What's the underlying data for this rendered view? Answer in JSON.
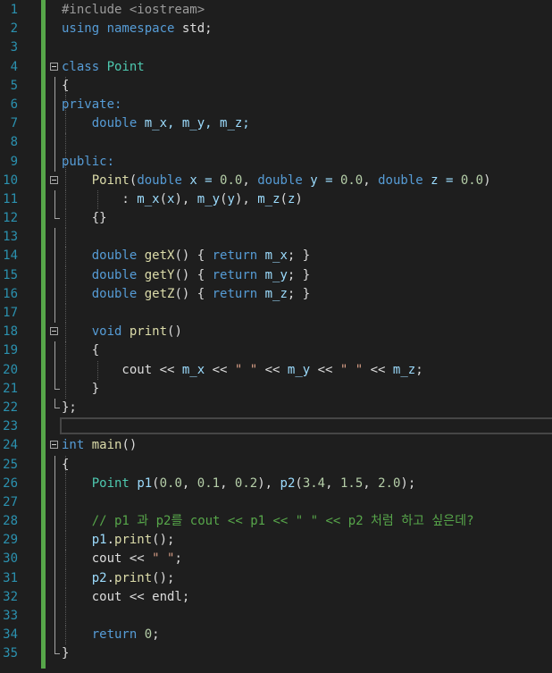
{
  "editor": {
    "current_line": 23,
    "lines": [
      {
        "n": "1",
        "tokens": [
          {
            "t": "#include <iostream>",
            "c": "pp"
          }
        ]
      },
      {
        "n": "2",
        "tokens": [
          {
            "t": "using namespace",
            "c": "kw"
          },
          {
            "t": " std;",
            "c": "pl"
          }
        ]
      },
      {
        "n": "3",
        "tokens": []
      },
      {
        "n": "4",
        "tokens": [
          {
            "t": "class",
            "c": "kw"
          },
          {
            "t": " ",
            "c": "pl"
          },
          {
            "t": "Point",
            "c": "ty"
          }
        ]
      },
      {
        "n": "5",
        "tokens": [
          {
            "t": "{",
            "c": "pl"
          }
        ]
      },
      {
        "n": "6",
        "tokens": [
          {
            "t": "private:",
            "c": "kw"
          }
        ]
      },
      {
        "n": "7",
        "tokens": [
          {
            "t": "    ",
            "c": "pl"
          },
          {
            "t": "double",
            "c": "kw"
          },
          {
            "t": " m_x, m_y, m_z;",
            "c": "var"
          }
        ]
      },
      {
        "n": "8",
        "tokens": []
      },
      {
        "n": "9",
        "tokens": [
          {
            "t": "public:",
            "c": "kw"
          }
        ]
      },
      {
        "n": "10",
        "tokens": [
          {
            "t": "    ",
            "c": "pl"
          },
          {
            "t": "Point",
            "c": "fn"
          },
          {
            "t": "(",
            "c": "pl"
          },
          {
            "t": "double",
            "c": "kw"
          },
          {
            "t": " x = ",
            "c": "var"
          },
          {
            "t": "0.0",
            "c": "num"
          },
          {
            "t": ", ",
            "c": "pl"
          },
          {
            "t": "double",
            "c": "kw"
          },
          {
            "t": " y = ",
            "c": "var"
          },
          {
            "t": "0.0",
            "c": "num"
          },
          {
            "t": ", ",
            "c": "pl"
          },
          {
            "t": "double",
            "c": "kw"
          },
          {
            "t": " z = ",
            "c": "var"
          },
          {
            "t": "0.0",
            "c": "num"
          },
          {
            "t": ")",
            "c": "pl"
          }
        ]
      },
      {
        "n": "11",
        "tokens": [
          {
            "t": "        : ",
            "c": "pl"
          },
          {
            "t": "m_x",
            "c": "var"
          },
          {
            "t": "(",
            "c": "pl"
          },
          {
            "t": "x",
            "c": "var"
          },
          {
            "t": "), ",
            "c": "pl"
          },
          {
            "t": "m_y",
            "c": "var"
          },
          {
            "t": "(",
            "c": "pl"
          },
          {
            "t": "y",
            "c": "var"
          },
          {
            "t": "), ",
            "c": "pl"
          },
          {
            "t": "m_z",
            "c": "var"
          },
          {
            "t": "(",
            "c": "pl"
          },
          {
            "t": "z",
            "c": "var"
          },
          {
            "t": ")",
            "c": "pl"
          }
        ]
      },
      {
        "n": "12",
        "tokens": [
          {
            "t": "    {}",
            "c": "pl"
          }
        ]
      },
      {
        "n": "13",
        "tokens": []
      },
      {
        "n": "14",
        "tokens": [
          {
            "t": "    ",
            "c": "pl"
          },
          {
            "t": "double",
            "c": "kw"
          },
          {
            "t": " ",
            "c": "pl"
          },
          {
            "t": "getX",
            "c": "fn"
          },
          {
            "t": "() { ",
            "c": "pl"
          },
          {
            "t": "return",
            "c": "kw"
          },
          {
            "t": " m_x",
            "c": "var"
          },
          {
            "t": "; }",
            "c": "pl"
          }
        ]
      },
      {
        "n": "15",
        "tokens": [
          {
            "t": "    ",
            "c": "pl"
          },
          {
            "t": "double",
            "c": "kw"
          },
          {
            "t": " ",
            "c": "pl"
          },
          {
            "t": "getY",
            "c": "fn"
          },
          {
            "t": "() { ",
            "c": "pl"
          },
          {
            "t": "return",
            "c": "kw"
          },
          {
            "t": " m_y",
            "c": "var"
          },
          {
            "t": "; }",
            "c": "pl"
          }
        ]
      },
      {
        "n": "16",
        "tokens": [
          {
            "t": "    ",
            "c": "pl"
          },
          {
            "t": "double",
            "c": "kw"
          },
          {
            "t": " ",
            "c": "pl"
          },
          {
            "t": "getZ",
            "c": "fn"
          },
          {
            "t": "() { ",
            "c": "pl"
          },
          {
            "t": "return",
            "c": "kw"
          },
          {
            "t": " m_z",
            "c": "var"
          },
          {
            "t": "; }",
            "c": "pl"
          }
        ]
      },
      {
        "n": "17",
        "tokens": []
      },
      {
        "n": "18",
        "tokens": [
          {
            "t": "    ",
            "c": "pl"
          },
          {
            "t": "void",
            "c": "kw"
          },
          {
            "t": " ",
            "c": "pl"
          },
          {
            "t": "print",
            "c": "fn"
          },
          {
            "t": "()",
            "c": "pl"
          }
        ]
      },
      {
        "n": "19",
        "tokens": [
          {
            "t": "    {",
            "c": "pl"
          }
        ]
      },
      {
        "n": "20",
        "tokens": [
          {
            "t": "        cout << ",
            "c": "pl"
          },
          {
            "t": "m_x",
            "c": "var"
          },
          {
            "t": " << ",
            "c": "pl"
          },
          {
            "t": "\" \"",
            "c": "str"
          },
          {
            "t": " << ",
            "c": "pl"
          },
          {
            "t": "m_y",
            "c": "var"
          },
          {
            "t": " << ",
            "c": "pl"
          },
          {
            "t": "\" \"",
            "c": "str"
          },
          {
            "t": " << ",
            "c": "pl"
          },
          {
            "t": "m_z",
            "c": "var"
          },
          {
            "t": ";",
            "c": "pl"
          }
        ]
      },
      {
        "n": "21",
        "tokens": [
          {
            "t": "    }",
            "c": "pl"
          }
        ]
      },
      {
        "n": "22",
        "tokens": [
          {
            "t": "};",
            "c": "pl"
          }
        ]
      },
      {
        "n": "23",
        "tokens": []
      },
      {
        "n": "24",
        "tokens": [
          {
            "t": "int",
            "c": "kw"
          },
          {
            "t": " ",
            "c": "pl"
          },
          {
            "t": "main",
            "c": "fn"
          },
          {
            "t": "()",
            "c": "pl"
          }
        ]
      },
      {
        "n": "25",
        "tokens": [
          {
            "t": "{",
            "c": "pl"
          }
        ]
      },
      {
        "n": "26",
        "tokens": [
          {
            "t": "    ",
            "c": "pl"
          },
          {
            "t": "Point",
            "c": "ty"
          },
          {
            "t": " ",
            "c": "pl"
          },
          {
            "t": "p1",
            "c": "var"
          },
          {
            "t": "(",
            "c": "pl"
          },
          {
            "t": "0.0",
            "c": "num"
          },
          {
            "t": ", ",
            "c": "pl"
          },
          {
            "t": "0.1",
            "c": "num"
          },
          {
            "t": ", ",
            "c": "pl"
          },
          {
            "t": "0.2",
            "c": "num"
          },
          {
            "t": "), ",
            "c": "pl"
          },
          {
            "t": "p2",
            "c": "var"
          },
          {
            "t": "(",
            "c": "pl"
          },
          {
            "t": "3.4",
            "c": "num"
          },
          {
            "t": ", ",
            "c": "pl"
          },
          {
            "t": "1.5",
            "c": "num"
          },
          {
            "t": ", ",
            "c": "pl"
          },
          {
            "t": "2.0",
            "c": "num"
          },
          {
            "t": ");",
            "c": "pl"
          }
        ]
      },
      {
        "n": "27",
        "tokens": []
      },
      {
        "n": "28",
        "tokens": [
          {
            "t": "    // p1 과 p2를 cout << p1 << \" \" << p2 처럼 하고 싶은데?",
            "c": "cm"
          }
        ]
      },
      {
        "n": "29",
        "tokens": [
          {
            "t": "    ",
            "c": "pl"
          },
          {
            "t": "p1",
            "c": "var"
          },
          {
            "t": ".",
            "c": "pl"
          },
          {
            "t": "print",
            "c": "fn"
          },
          {
            "t": "();",
            "c": "pl"
          }
        ]
      },
      {
        "n": "30",
        "tokens": [
          {
            "t": "    cout << ",
            "c": "pl"
          },
          {
            "t": "\" \"",
            "c": "str"
          },
          {
            "t": ";",
            "c": "pl"
          }
        ]
      },
      {
        "n": "31",
        "tokens": [
          {
            "t": "    ",
            "c": "pl"
          },
          {
            "t": "p2",
            "c": "var"
          },
          {
            "t": ".",
            "c": "pl"
          },
          {
            "t": "print",
            "c": "fn"
          },
          {
            "t": "();",
            "c": "pl"
          }
        ]
      },
      {
        "n": "32",
        "tokens": [
          {
            "t": "    cout << endl;",
            "c": "pl"
          }
        ]
      },
      {
        "n": "33",
        "tokens": []
      },
      {
        "n": "34",
        "tokens": [
          {
            "t": "    ",
            "c": "pl"
          },
          {
            "t": "return",
            "c": "kw"
          },
          {
            "t": " ",
            "c": "pl"
          },
          {
            "t": "0",
            "c": "num"
          },
          {
            "t": ";",
            "c": "pl"
          }
        ]
      },
      {
        "n": "35",
        "tokens": [
          {
            "t": "}",
            "c": "pl"
          }
        ]
      }
    ]
  }
}
